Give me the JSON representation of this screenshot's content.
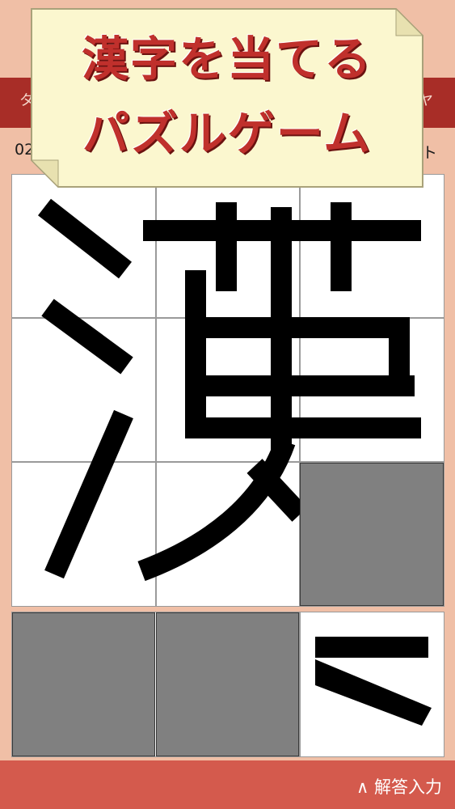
{
  "header": {
    "left_text": "タ",
    "right_text": "ヤ"
  },
  "subbar": {
    "left_text": "02",
    "right_text": "ト"
  },
  "banner": {
    "line1": "漢字を当てる",
    "line2": "パズルゲーム"
  },
  "bottom": {
    "answer_button_label": "∧ 解答入力"
  },
  "colors": {
    "header_bar": "#a82d27",
    "background": "#f0bfa6",
    "banner_bg": "#fbf7cf",
    "banner_text": "#c0302c",
    "gray_tile": "#808080",
    "bottom_bar": "#d45a4d"
  }
}
